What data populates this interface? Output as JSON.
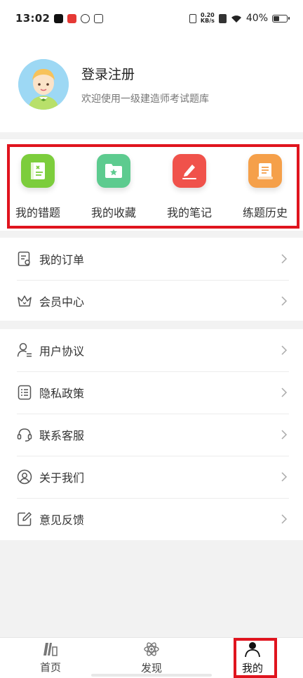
{
  "status_bar": {
    "time": "13:02",
    "speed_value": "0.20",
    "speed_unit": "KB/s",
    "battery_text": "40%",
    "battery_level": 0.4
  },
  "profile": {
    "title": "登录注册",
    "subtitle": "欢迎使用一级建造师考试题库"
  },
  "quick_actions": [
    {
      "label": "我的错题",
      "icon": "wrong-questions-icon",
      "color": "#7ccd3c"
    },
    {
      "label": "我的收藏",
      "icon": "favorites-folder-icon",
      "color": "#5dcb8f"
    },
    {
      "label": "我的笔记",
      "icon": "notes-pen-icon",
      "color": "#f0524b"
    },
    {
      "label": "练题历史",
      "icon": "history-scroll-icon",
      "color": "#f5a04a"
    }
  ],
  "menu_group_1": [
    {
      "label": "我的订单",
      "icon": "order-icon"
    },
    {
      "label": "会员中心",
      "icon": "crown-icon"
    }
  ],
  "menu_group_2": [
    {
      "label": "用户协议",
      "icon": "user-agreement-icon"
    },
    {
      "label": "隐私政策",
      "icon": "privacy-list-icon"
    },
    {
      "label": "联系客服",
      "icon": "headset-icon"
    },
    {
      "label": "关于我们",
      "icon": "about-user-icon"
    },
    {
      "label": "意见反馈",
      "icon": "feedback-edit-icon"
    }
  ],
  "tabs": [
    {
      "label": "首页",
      "icon": "home-books-icon"
    },
    {
      "label": "发现",
      "icon": "discover-atom-icon"
    },
    {
      "label": "我的",
      "icon": "profile-person-icon",
      "active": true
    }
  ],
  "colors": {
    "highlight": "#e0141e",
    "background": "#f2f2f2"
  }
}
